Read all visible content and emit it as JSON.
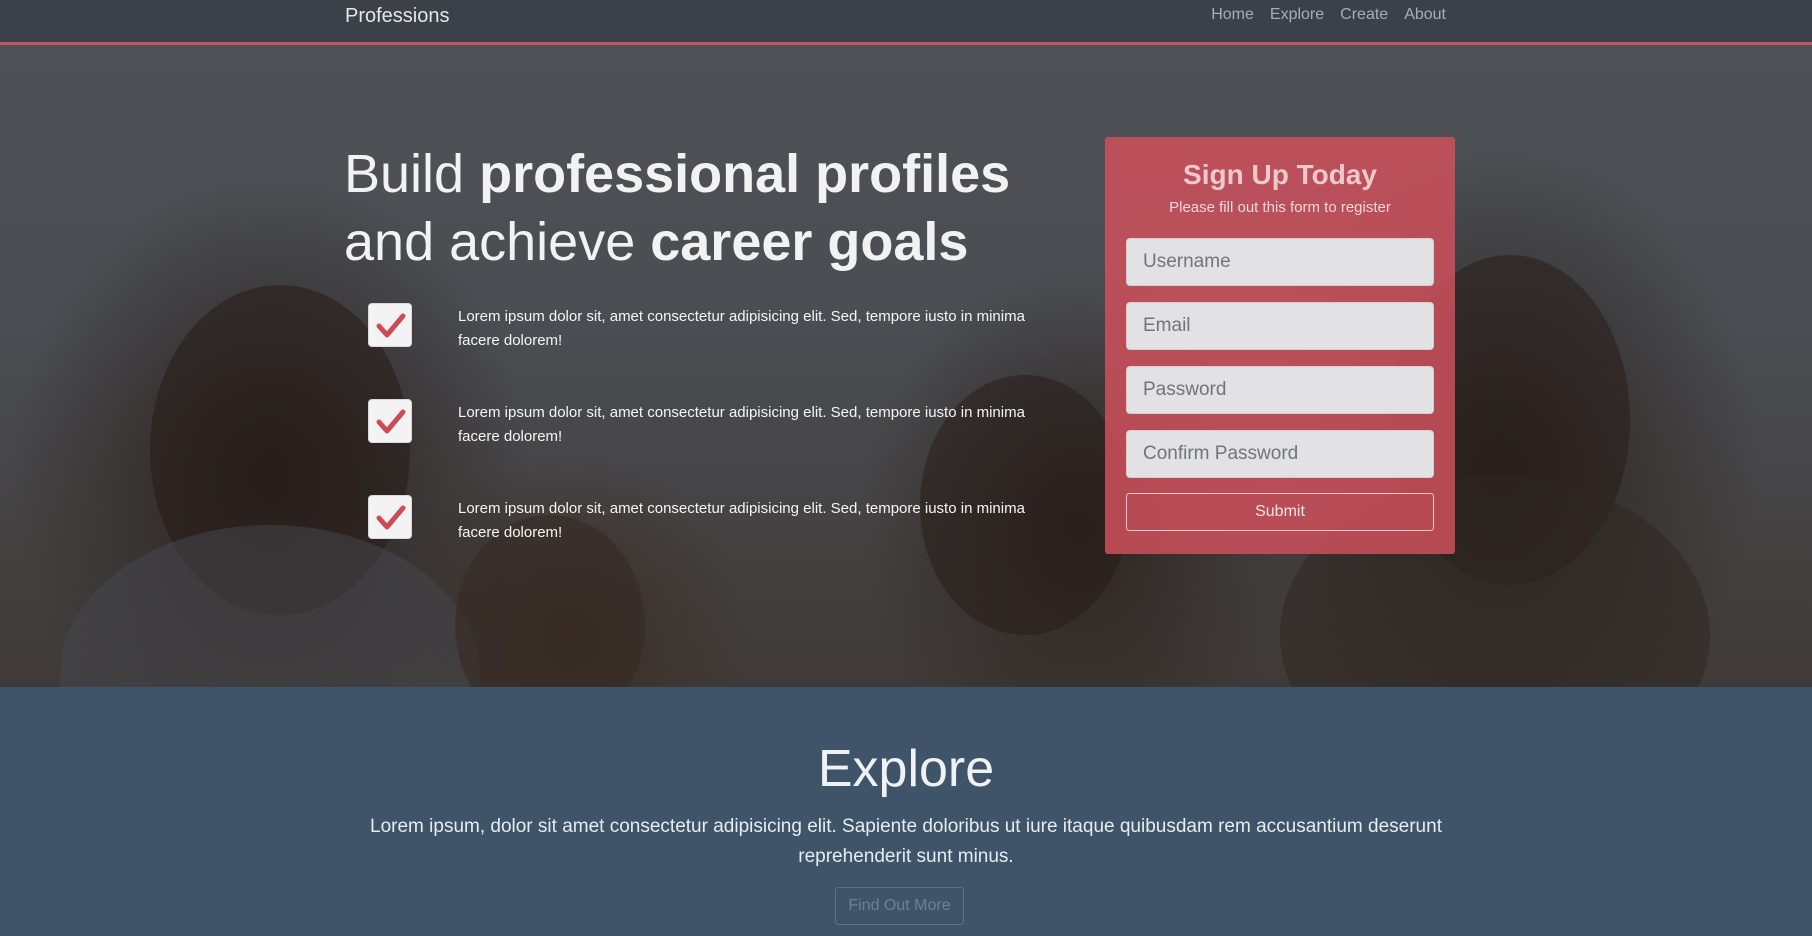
{
  "navbar": {
    "brand": "Professions",
    "links": [
      "Home",
      "Explore",
      "Create",
      "About"
    ]
  },
  "hero": {
    "headline": {
      "line1_light": "Build ",
      "line1_bold": "professional profiles",
      "line2_light": "and achieve ",
      "line2_bold": "career goals"
    },
    "features": [
      {
        "icon": "check-icon",
        "text": "Lorem ipsum dolor sit, amet consectetur adipisicing elit. Sed, tempore iusto in minima facere dolorem!"
      },
      {
        "icon": "check-icon",
        "text": "Lorem ipsum dolor sit, amet consectetur adipisicing elit. Sed, tempore iusto in minima facere dolorem!"
      },
      {
        "icon": "check-icon",
        "text": "Lorem ipsum dolor sit, amet consectetur adipisicing elit. Sed, tempore iusto in minima facere dolorem!"
      }
    ]
  },
  "signup": {
    "title": "Sign Up Today",
    "subtitle": "Please fill out this form to register",
    "username_placeholder": "Username",
    "email_placeholder": "Email",
    "password_placeholder": "Password",
    "confirm_placeholder": "Confirm Password",
    "submit_label": "Submit"
  },
  "explore": {
    "title": "Explore",
    "text": "Lorem ipsum, dolor sit amet consectetur adipisicing elit. Sapiente doloribus ut iure itaque quibusdam rem accusantium deserunt reprehenderit sunt minus.",
    "button_label": "Find Out More"
  },
  "colors": {
    "accent": "#c45560",
    "navbar_bg": "#3b4049",
    "explore_bg": "#3f5468"
  }
}
